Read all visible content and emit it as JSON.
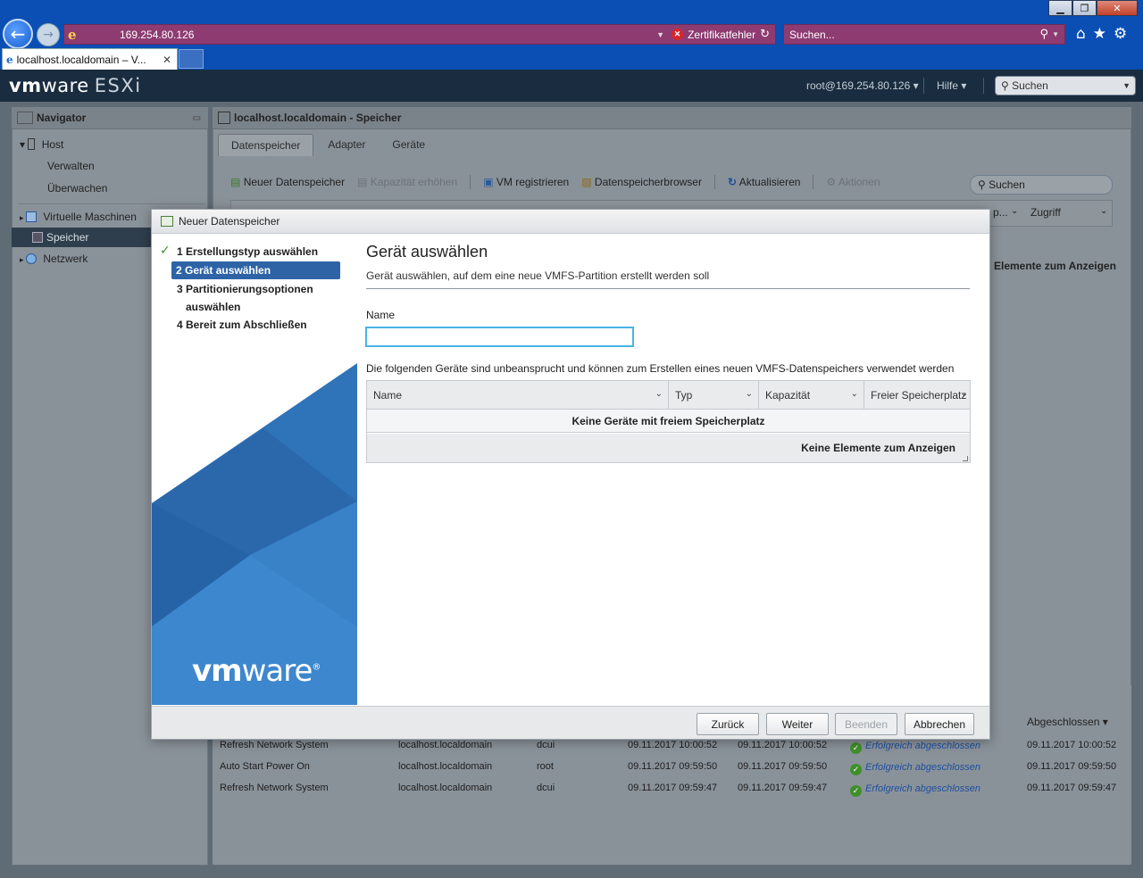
{
  "browser": {
    "address": "169.254.80.126",
    "cert_error": "Zertifikatfehler",
    "search_placeholder": "Suchen...",
    "tab_title": "localhost.localdomain – V..."
  },
  "esxi": {
    "logo_vm": "vm",
    "logo_ware": "ware",
    "logo_product": "ESXi",
    "user_menu": "root@169.254.80.126 ▾",
    "help_menu": "Hilfe ▾",
    "search_label": "Suchen"
  },
  "navigator": {
    "title": "Navigator",
    "host": "Host",
    "verwalten": "Verwalten",
    "ueberwachen": "Überwachen",
    "vms": "Virtuelle Maschinen",
    "speicher": "Speicher",
    "netzwerk": "Netzwerk"
  },
  "main": {
    "title": "localhost.localdomain - Speicher",
    "tabs": [
      {
        "label": "Datenspeicher"
      },
      {
        "label": "Adapter"
      },
      {
        "label": "Geräte"
      }
    ],
    "toolbar": {
      "new": "Neuer Datenspeicher",
      "increase": "Kapazität erhöhen",
      "register": "VM registrieren",
      "browser": "Datenspeicherbrowser",
      "refresh": "Aktualisieren",
      "actions": "Aktionen"
    },
    "search": "Suchen",
    "col_p": "p...",
    "col_access": "Zugriff",
    "empty": "Elemente zum Anzeigen"
  },
  "tasks": {
    "col_completed": "Abgeschlossen ▾",
    "rows": [
      {
        "task": "Refresh Network System",
        "target": "localhost.localdomain",
        "initiator": "dcui",
        "queued": "09.11.2017 10:00:52",
        "started": "09.11.2017 10:00:52",
        "result": "Erfolgreich abgeschlossen",
        "completed": "09.11.2017 10:00:52"
      },
      {
        "task": "Auto Start Power On",
        "target": "localhost.localdomain",
        "initiator": "root",
        "queued": "09.11.2017 09:59:50",
        "started": "09.11.2017 09:59:50",
        "result": "Erfolgreich abgeschlossen",
        "completed": "09.11.2017 09:59:50"
      },
      {
        "task": "Refresh Network System",
        "target": "localhost.localdomain",
        "initiator": "dcui",
        "queued": "09.11.2017 09:59:47",
        "started": "09.11.2017 09:59:47",
        "result": "Erfolgreich abgeschlossen",
        "completed": "09.11.2017 09:59:47"
      }
    ]
  },
  "wizard": {
    "title": "Neuer Datenspeicher",
    "steps": {
      "s1": "1  Erstellungstyp auswählen",
      "s2": "2  Gerät auswählen",
      "s3a": "3  Partitionierungsoptionen",
      "s3b": "auswählen",
      "s4": "4  Bereit zum Abschließen"
    },
    "brand_vm": "vm",
    "brand_ware": "ware",
    "brand_reg": "®",
    "heading": "Gerät auswählen",
    "subheading": "Gerät auswählen, auf dem eine neue VMFS-Partition erstellt werden soll",
    "name_label": "Name",
    "name_value": "",
    "devices_hint": "Die folgenden Geräte sind unbeansprucht und können zum Erstellen eines neuen VMFS-Datenspeichers verwendet werden",
    "columns": [
      "Name",
      "Typ",
      "Kapazität",
      "Freier Speicherplatz"
    ],
    "no_devices": "Keine Geräte mit freiem Speicherplatz",
    "no_items": "Keine Elemente zum Anzeigen",
    "buttons": {
      "back": "Zurück",
      "next": "Weiter",
      "finish": "Beenden",
      "cancel": "Abbrechen"
    }
  }
}
